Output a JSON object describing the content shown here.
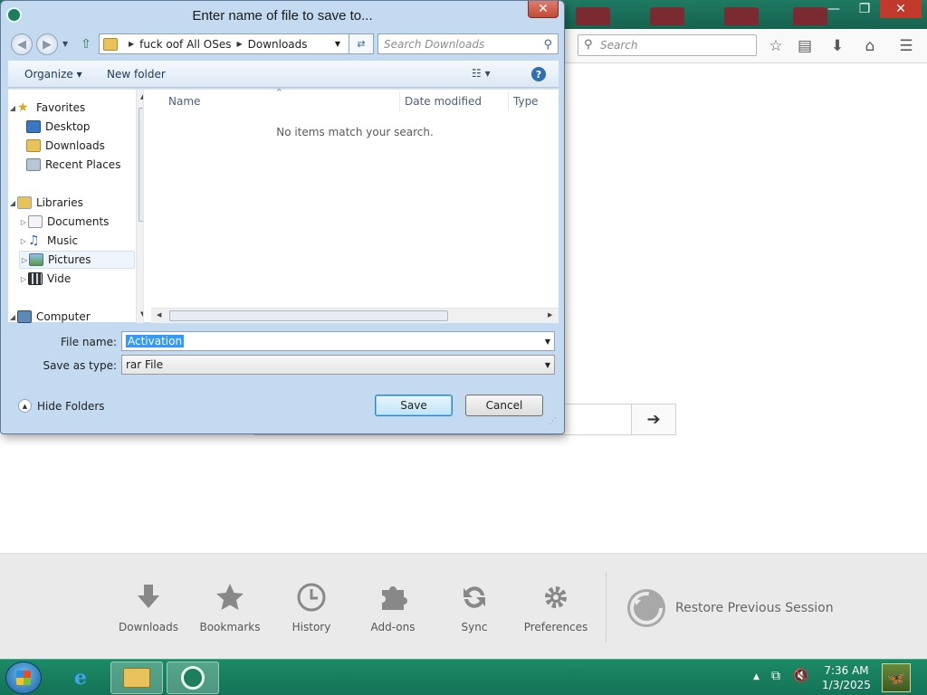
{
  "browser": {
    "search_placeholder": "Search",
    "win_minimize": "—",
    "win_restore": "❐",
    "win_close": "✕",
    "launcher": [
      {
        "label": "Downloads",
        "icon": "download-icon"
      },
      {
        "label": "Bookmarks",
        "icon": "star-icon"
      },
      {
        "label": "History",
        "icon": "clock-icon"
      },
      {
        "label": "Add-ons",
        "icon": "puzzle-icon"
      },
      {
        "label": "Sync",
        "icon": "sync-icon"
      },
      {
        "label": "Preferences",
        "icon": "gear-icon"
      }
    ],
    "restore_session": "Restore Previous Session"
  },
  "dialog": {
    "title": "Enter name of file to save to...",
    "address": {
      "segment1": "fuck oof All OSes",
      "segment2": "Downloads"
    },
    "search_placeholder": "Search Downloads",
    "organize": "Organize ▾",
    "new_folder": "New folder",
    "nav": {
      "favorites": "Favorites",
      "desktop": "Desktop",
      "downloads": "Downloads",
      "recent": "Recent Places",
      "libraries": "Libraries",
      "documents": "Documents",
      "music": "Music",
      "pictures": "Pictures",
      "videos": "Vide",
      "computer": "Computer"
    },
    "columns": {
      "name": "Name",
      "date": "Date modified",
      "type": "Type"
    },
    "empty_message": "No items match your search.",
    "file_name_label": "File name:",
    "file_name_value": "Activation",
    "save_type_label": "Save as type:",
    "save_type_value": "rar File",
    "hide_folders": "Hide Folders",
    "save": "Save",
    "cancel": "Cancel"
  },
  "taskbar": {
    "time": "7:36 AM",
    "date": "1/3/2025"
  },
  "colors": {
    "titlebar": "#1f7a62",
    "dialog_frame": "#c3daf0",
    "taskbar": "#1c8a66",
    "selection": "#3399ff"
  }
}
